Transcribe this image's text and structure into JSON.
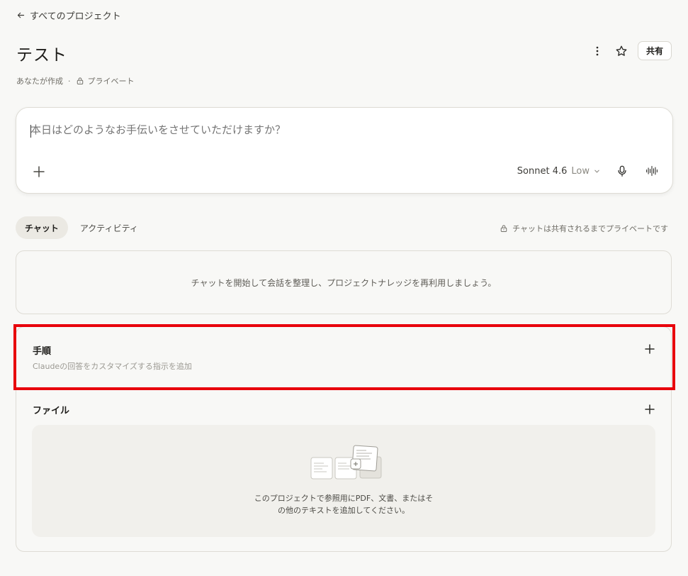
{
  "nav": {
    "back_label": "すべてのプロジェクト"
  },
  "project": {
    "title": "テスト",
    "created_by": "あなたが作成",
    "separator": "·",
    "visibility": "プライベート"
  },
  "actions": {
    "share_label": "共有"
  },
  "composer": {
    "placeholder": "本日はどのようなお手伝いをさせていただけますか？",
    "model": "Sonnet 4.6",
    "effort": "Low"
  },
  "tabs": [
    {
      "label": "チャット",
      "active": true
    },
    {
      "label": "アクティビティ",
      "active": false
    }
  ],
  "privacy_note": "チャットは共有されるまでプライベートです",
  "chats_empty": "チャットを開始して会話を整理し、プロジェクトナレッジを再利用しましょう。",
  "instructions": {
    "title": "手順",
    "subtitle": "Claudeの回答をカスタマイズする指示を追加"
  },
  "files": {
    "title": "ファイル",
    "empty_line1": "このプロジェクトで参照用にPDF、文書、またはそ",
    "empty_line2": "の他のテキストを追加してください。"
  },
  "colors": {
    "background": "#f8f8f6",
    "highlight": "#e8000b",
    "border": "#dedcd5",
    "active_tab": "#ebe9e3"
  }
}
